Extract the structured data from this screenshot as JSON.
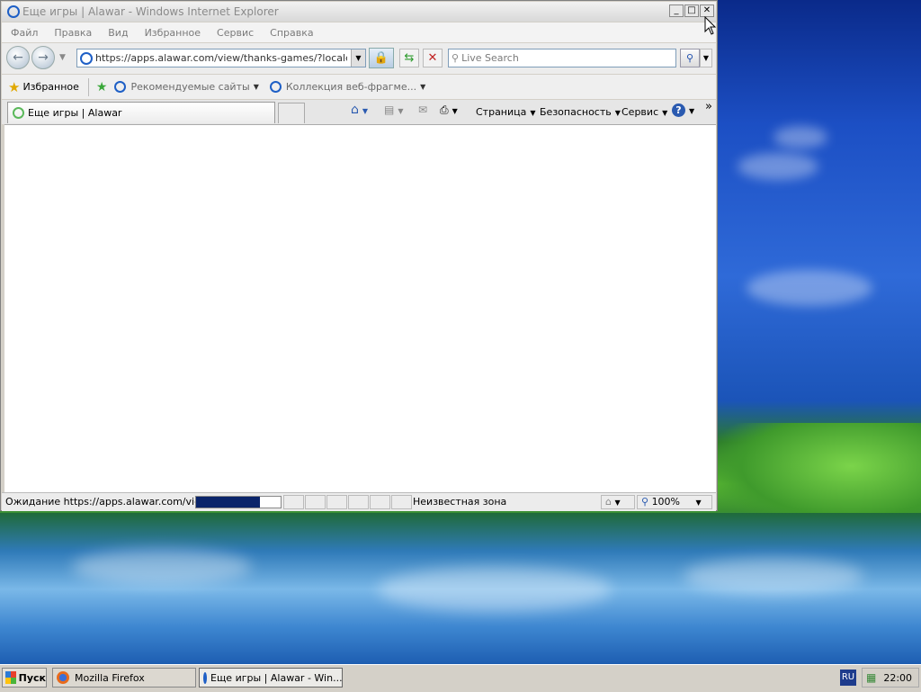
{
  "window": {
    "title": "Еще игры | Alawar - Windows Internet Explorer"
  },
  "menubar": {
    "items": [
      "Файл",
      "Правка",
      "Вид",
      "Избранное",
      "Сервис",
      "Справка"
    ]
  },
  "navbar": {
    "address": "https://apps.alawar.com/view/thanks-games/?locale=ru&p",
    "search_placeholder": "Live Search"
  },
  "favorites": {
    "label": "Избранное",
    "links": [
      "Рекомендуемые сайты",
      "Коллекция веб-фрагме..."
    ]
  },
  "tabs": {
    "active_title": "Еще игры | Alawar"
  },
  "commandbar": {
    "page": "Страница",
    "safety": "Безопасность",
    "tools": "Сервис"
  },
  "statusbar": {
    "text": "Ожидание https://apps.alawar.com/view/",
    "progress": 0.75,
    "zone": "Неизвестная зона",
    "zoom": "100%"
  },
  "taskbar": {
    "start": "Пуск",
    "buttons": [
      "Mozilla Firefox",
      "Еще игры | Alawar - Win..."
    ],
    "lang": "RU",
    "clock": "22:00"
  },
  "colors": {
    "progress_fill": "#0a246a",
    "ie_blue": "#1e5fc6"
  }
}
